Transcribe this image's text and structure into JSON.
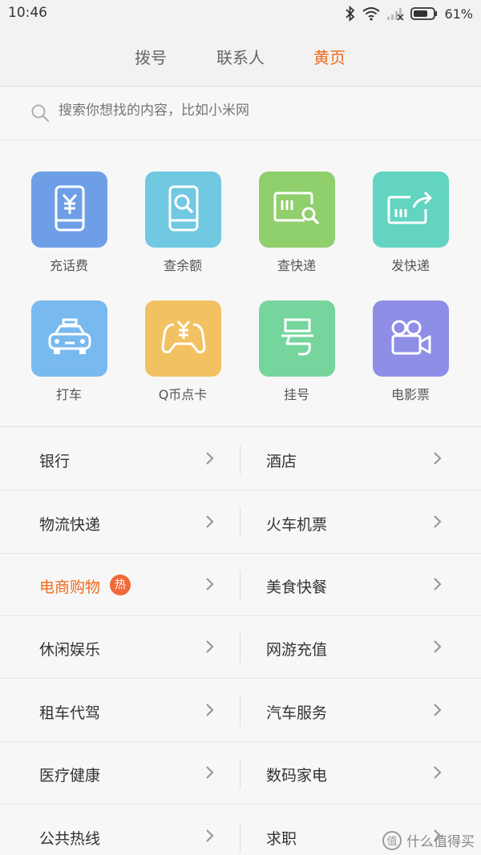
{
  "status_bar": {
    "time": "10:46",
    "battery": "61%"
  },
  "tabs": [
    {
      "label": "拨号",
      "active": false
    },
    {
      "label": "联系人",
      "active": false
    },
    {
      "label": "黄页",
      "active": true
    }
  ],
  "search": {
    "placeholder": "搜索你想找的内容，比如小米网"
  },
  "services": [
    {
      "label": "充话费",
      "icon": "phone-yuan-icon",
      "color": "#6e9fe6"
    },
    {
      "label": "查余额",
      "icon": "phone-search-icon",
      "color": "#71c8e1"
    },
    {
      "label": "查快递",
      "icon": "card-search-icon",
      "color": "#8fcf6c"
    },
    {
      "label": "发快递",
      "icon": "card-send-icon",
      "color": "#62d4c0"
    },
    {
      "label": "打车",
      "icon": "taxi-icon",
      "color": "#78b9ef"
    },
    {
      "label": "Q币点卡",
      "icon": "gamepad-yuan-icon",
      "color": "#f2c161"
    },
    {
      "label": "挂号",
      "icon": "hao-character-icon",
      "color": "#76d59d"
    },
    {
      "label": "电影票",
      "icon": "movie-camera-icon",
      "color": "#8f8ee6"
    }
  ],
  "categories": [
    {
      "left": "银行",
      "right": "酒店"
    },
    {
      "left": "物流快递",
      "right": "火车机票"
    },
    {
      "left": "电商购物",
      "left_badge": "热",
      "right": "美食快餐"
    },
    {
      "left": "休闲娱乐",
      "right": "网游充值"
    },
    {
      "left": "租车代驾",
      "right": "汽车服务"
    },
    {
      "left": "医疗健康",
      "right": "数码家电"
    },
    {
      "left": "公共热线",
      "right": "求职"
    }
  ],
  "watermark": {
    "text": "什么值得买",
    "mark": "值"
  },
  "colors": {
    "accent": "#ef6a1c",
    "badge": "#f06a3a"
  }
}
